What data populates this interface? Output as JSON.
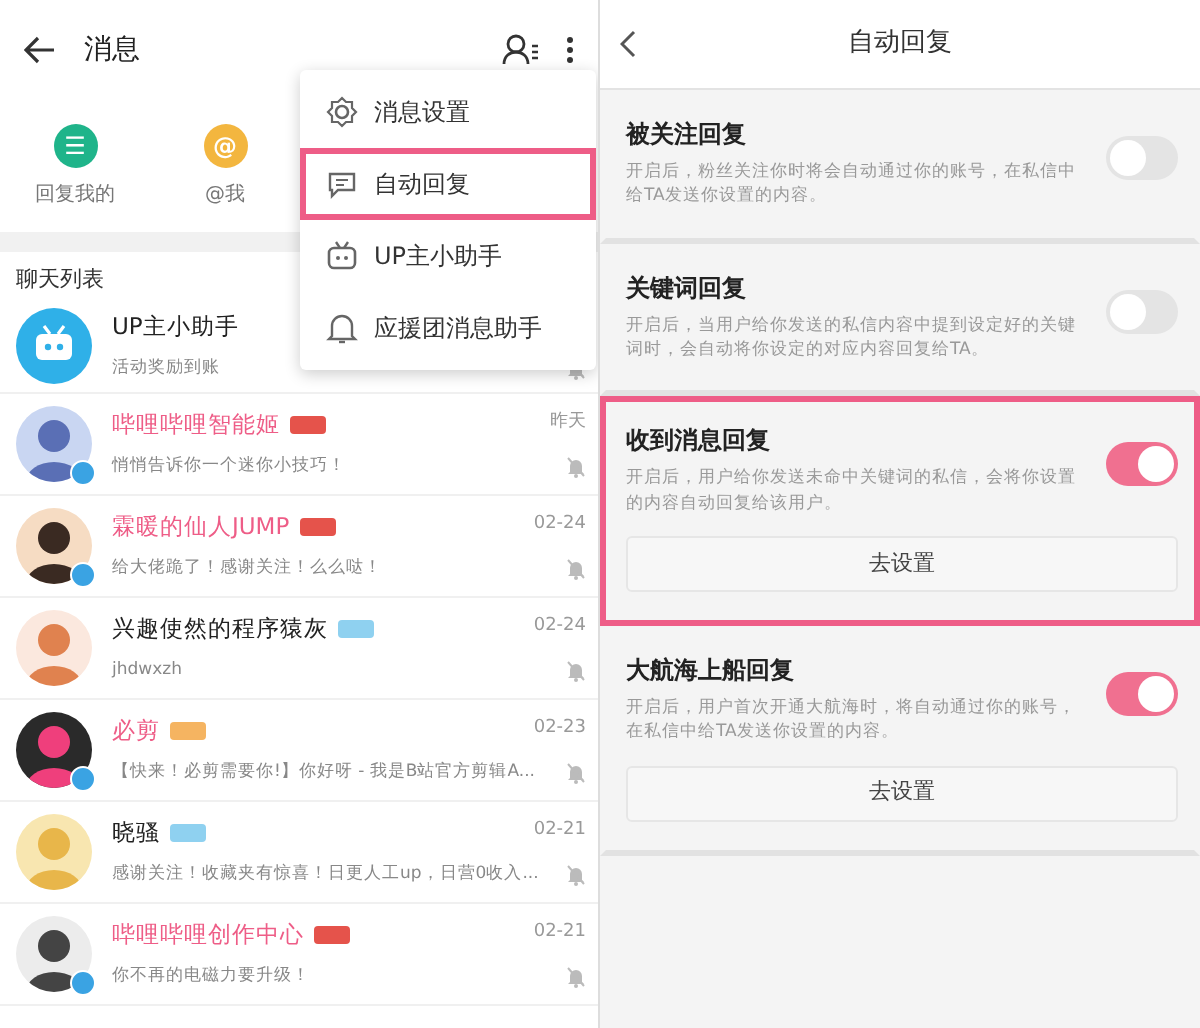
{
  "messages_screen": {
    "title": "消息",
    "quick_links": [
      {
        "label": "回复我的",
        "color": "#1fb48a",
        "glyph": "☰"
      },
      {
        "label": "@我",
        "color": "#f3b63f",
        "glyph": "@"
      }
    ],
    "section_title": "聊天列表",
    "chats": [
      {
        "name": "UP主小助手",
        "preview": "活动奖励到账",
        "kind": "assistant",
        "vip": false,
        "muted": true
      },
      {
        "name": "哔哩哔哩智能姬",
        "preview": "悄悄告诉你一个迷你小技巧！",
        "time": "昨天",
        "kind": "avatar",
        "vip": true,
        "color": "#e5534b",
        "verified": true,
        "muted": true
      },
      {
        "name": "霖暖的仙人JUMP",
        "preview": "给大佬跪了！感谢关注！么么哒！",
        "time": "02-24",
        "kind": "avatar",
        "vip": true,
        "color": "#e5534b",
        "verified": true,
        "muted": true
      },
      {
        "name": "兴趣使然的程序猿灰",
        "preview": "jhdwxzh",
        "time": "02-24",
        "kind": "avatar",
        "vip": false,
        "color": "#8fd1f0",
        "verified": false,
        "muted": true
      },
      {
        "name": "必剪",
        "preview": "【快来！必剪需要你!】你好呀 - 我是B站官方剪辑A...",
        "time": "02-23",
        "kind": "avatar",
        "vip": true,
        "color": "#f5b461",
        "verified": true,
        "muted": true
      },
      {
        "name": "晓骚",
        "preview": "感谢关注！收藏夹有惊喜！日更人工up，日营0收入...",
        "time": "02-21",
        "kind": "avatar",
        "vip": false,
        "color": "#8fd1f0",
        "verified": false,
        "muted": true
      },
      {
        "name": "哔哩哔哩创作中心",
        "preview": "你不再的电磁力要升级！",
        "time": "02-21",
        "kind": "avatar",
        "vip": true,
        "color": "#e5534b",
        "verified": true,
        "muted": true
      }
    ],
    "menu": [
      {
        "label": "消息设置",
        "kind": "gear",
        "highlighted": false
      },
      {
        "label": "自动回复",
        "kind": "chat",
        "highlighted": true
      },
      {
        "label": "UP主小助手",
        "kind": "tv",
        "highlighted": false
      },
      {
        "label": "应援团消息助手",
        "kind": "bell",
        "highlighted": false
      }
    ]
  },
  "auto_reply_screen": {
    "title": "自动回复",
    "options": [
      {
        "title": "被关注回复",
        "description": "开启后，粉丝关注你时将会自动通过你的账号，在私信中给TA发送你设置的内容。",
        "on": false,
        "highlighted": false
      },
      {
        "title": "关键词回复",
        "description": "开启后，当用户给你发送的私信内容中提到设定好的关键词时，会自动将你设定的对应内容回复给TA。",
        "on": false,
        "highlighted": false
      },
      {
        "title": "收到消息回复",
        "description": "开启后，用户给你发送未命中关键词的私信，会将你设置的内容自动回复给该用户。",
        "on": true,
        "highlighted": true,
        "button": "去设置"
      },
      {
        "title": "大航海上船回复",
        "description": "开启后，用户首次开通大航海时，将自动通过你的账号，在私信中给TA发送你设置的内容。",
        "on": true,
        "highlighted": false,
        "button": "去设置"
      }
    ]
  }
}
